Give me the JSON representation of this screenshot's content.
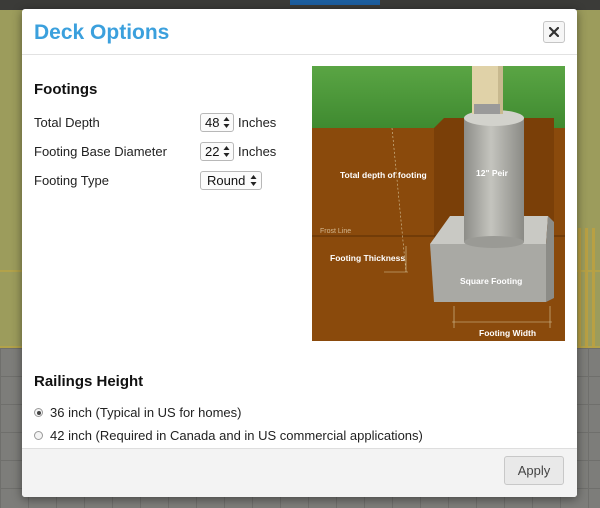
{
  "dialog": {
    "title": "Deck Options",
    "close_symbol": "close-icon"
  },
  "footings": {
    "heading": "Footings",
    "total_depth": {
      "label": "Total Depth",
      "value": "48",
      "unit": "Inches"
    },
    "base_diameter": {
      "label": "Footing Base Diameter",
      "value": "22",
      "unit": "Inches"
    },
    "footing_type": {
      "label": "Footing Type",
      "selected": "Round"
    }
  },
  "diagram": {
    "labels": {
      "total_depth": "Total depth of footing",
      "pier": "12\" Peir",
      "frost_line": "Frost Line",
      "thickness": "Footing Thickness",
      "square_footing": "Square Footing",
      "width": "Footing Width"
    },
    "colors": {
      "grass": "#4f9a3c",
      "soil": "#8a4a0c",
      "concrete": "#b0b0aa",
      "post": "#e0d2a8"
    }
  },
  "railings": {
    "heading": "Railings Height",
    "options": [
      {
        "label": "36 inch (Typical in US for homes)",
        "checked": true
      },
      {
        "label": "42 inch (Required in Canada and in US commercial applications)",
        "checked": false
      }
    ]
  },
  "footer": {
    "apply_label": "Apply"
  }
}
